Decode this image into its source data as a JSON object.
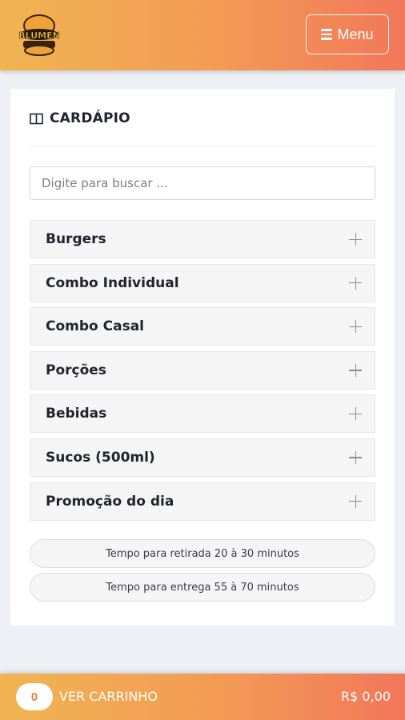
{
  "header": {
    "logo_name": "BLUMEN",
    "menu_label": "Menu"
  },
  "card": {
    "title": "CARDÁPIO",
    "search_placeholder": "Digite para buscar ...",
    "categories": [
      {
        "label": "Burgers"
      },
      {
        "label": "Combo Individual"
      },
      {
        "label": "Combo Casal"
      },
      {
        "label": "Porções"
      },
      {
        "label": "Bebidas"
      },
      {
        "label": "Sucos (500ml)"
      },
      {
        "label": "Promoção do dia"
      }
    ],
    "pickup_time": "Tempo para retirada 20 à 30 minutos",
    "delivery_time": "Tempo para entrega 55 à 70 minutos"
  },
  "footer": {
    "cart_count": "0",
    "cart_label": "VER CARRINHO",
    "cart_total": "R$ 0,00"
  },
  "colors": {
    "header_gradient_start": "#f1b451",
    "header_gradient_end": "#f2775a",
    "background": "#edf0f4"
  }
}
